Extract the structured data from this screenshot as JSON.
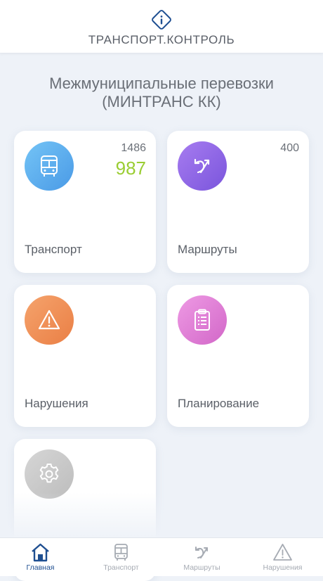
{
  "header": {
    "logo_icon": "info-diamond-icon",
    "title": "ТРАНСПОРТ.КОНТРОЛЬ"
  },
  "organization": {
    "title_line1": "Межмуниципальные перевозки",
    "title_line2": "(МИНТРАНС КК)"
  },
  "cards": {
    "transport": {
      "label": "Транспорт",
      "total": "1486",
      "active": "987",
      "icon": "bus-icon",
      "color": "#5aaeee"
    },
    "routes": {
      "label": "Маршруты",
      "total": "400",
      "icon": "route-icon",
      "color": "#8e63e6"
    },
    "violations": {
      "label": "Нарушения",
      "icon": "warning-icon",
      "color": "#f0935a"
    },
    "planning": {
      "label": "Планирование",
      "icon": "clipboard-icon",
      "color": "#e07cd6"
    },
    "settings": {
      "icon": "gear-icon",
      "color": "#c9c9c9"
    }
  },
  "tabbar": {
    "active_color": "#1f4f91",
    "inactive_color": "#a6abb3",
    "items": [
      {
        "label": "Главная",
        "icon": "home-icon",
        "active": true
      },
      {
        "label": "Транспорт",
        "icon": "bus-icon",
        "active": false
      },
      {
        "label": "Маршруты",
        "icon": "route-icon",
        "active": false
      },
      {
        "label": "Нарушения",
        "icon": "warning-icon",
        "active": false
      }
    ]
  }
}
